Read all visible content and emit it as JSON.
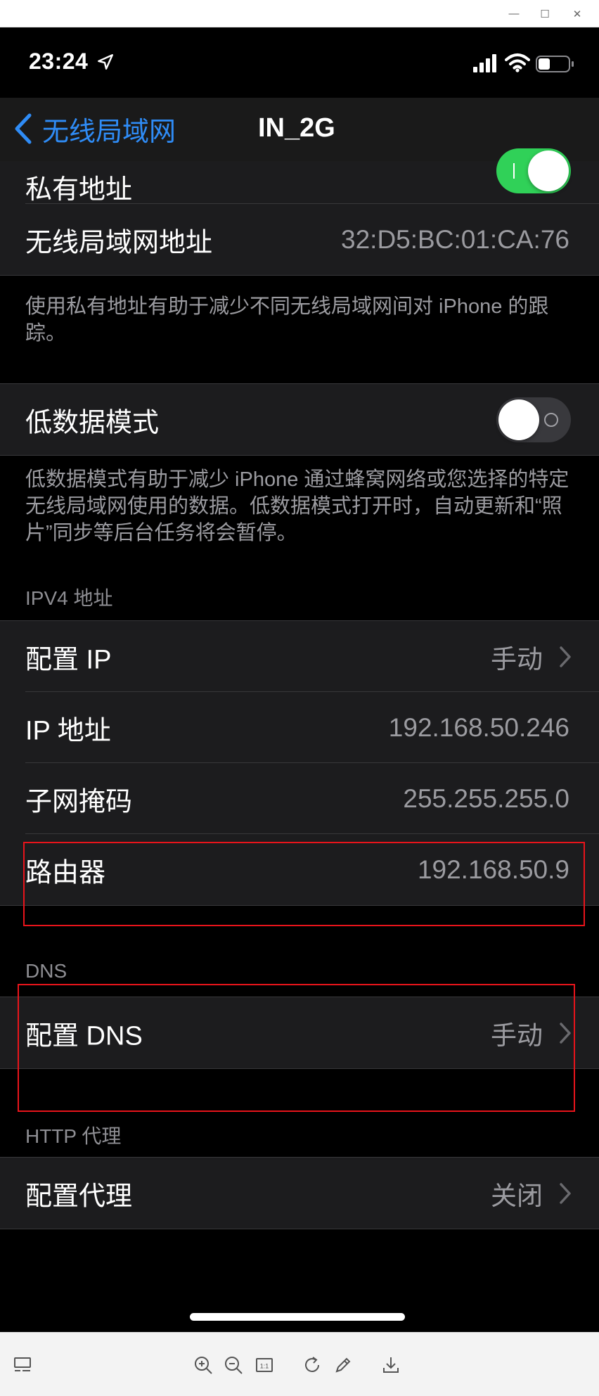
{
  "window": {
    "minimize_glyph": "—",
    "maximize_glyph": "☐",
    "close_glyph": "✕"
  },
  "status_bar": {
    "time": "23:24",
    "icons": [
      "location-arrow-icon",
      "cellular-signal-icon",
      "wifi-icon",
      "battery-icon"
    ]
  },
  "nav": {
    "back_label": "无线局域网",
    "title": "IN_2G"
  },
  "private_address": {
    "label": "私有地址",
    "toggle_on": true
  },
  "wlan_address": {
    "label": "无线局域网地址",
    "value": "32:D5:BC:01:CA:76"
  },
  "private_note": "使用私有地址有助于减少不同无线局域网间对 iPhone 的跟踪。",
  "low_data": {
    "label": "低数据模式",
    "toggle_on": false,
    "note": "低数据模式有助于减少 iPhone 通过蜂窝网络或您选择的特定无线局域网使用的数据。低数据模式打开时，自动更新和“照片”同步等后台任务将会暂停。"
  },
  "ipv4": {
    "header": "IPV4 地址",
    "configure": {
      "label": "配置 IP",
      "value": "手动"
    },
    "ip": {
      "label": "IP 地址",
      "value": "192.168.50.246"
    },
    "subnet": {
      "label": "子网掩码",
      "value": "255.255.255.0"
    },
    "router": {
      "label": "路由器",
      "value": "192.168.50.9"
    }
  },
  "dns": {
    "header": "DNS",
    "configure": {
      "label": "配置 DNS",
      "value": "手动"
    }
  },
  "proxy": {
    "header": "HTTP 代理",
    "configure": {
      "label": "配置代理",
      "value": "关闭"
    }
  },
  "viewer_toolbar": {
    "tools": [
      "thumbnail-icon",
      "zoom-in-icon",
      "zoom-out-icon",
      "actual-size-icon",
      "rotate-icon",
      "edit-icon",
      "download-icon"
    ],
    "actual_size_label": "1:1"
  },
  "colors": {
    "accent": "#2f8cf6",
    "toggle_on": "#30d158",
    "cell_bg": "#1c1c1e",
    "secondary_text": "#9b9ba0",
    "annotation_red": "#e8141b"
  }
}
